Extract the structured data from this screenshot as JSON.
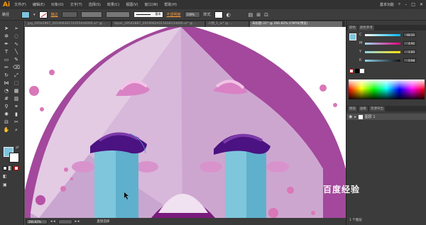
{
  "app": {
    "logo": "Ai"
  },
  "menu": {
    "items": [
      "文件(F)",
      "编辑(E)",
      "对象(O)",
      "文字(T)",
      "选择(S)",
      "效果(C)",
      "视图(V)",
      "窗口(W)",
      "帮助(H)"
    ],
    "workspace": "基本功能"
  },
  "control": {
    "path_label": "路径",
    "stroke_label": "描边",
    "brush_label": "基本",
    "opacity_label": "不透明度",
    "opacity_value": "100%",
    "style_label": "样式"
  },
  "tabs": [
    {
      "label": "jpg_29542867_20190626174355044000.ai* @ ...",
      "active": false
    },
    {
      "label": "Hpair_29542867_20190624311818154000.ai* @ ...",
      "active": false
    },
    {
      "label": "人物_1_ai* @ ...",
      "active": false
    },
    {
      "label": "未标题-31* @ 266.82% (CMYK/预览)",
      "active": true
    }
  ],
  "status": {
    "zoom": "266.82%",
    "tool": "直接选择"
  },
  "color_panel": {
    "tabs": [
      "颜色",
      "颜色参考"
    ],
    "channels": [
      {
        "label": "C",
        "value": "48.31",
        "color": "#00b7f0"
      },
      {
        "label": "M",
        "value": "4.91",
        "color": "#e5007e"
      },
      {
        "label": "Y",
        "value": "1.95",
        "color": "#ffe600"
      },
      {
        "label": "K",
        "value": "0.98",
        "color": "#111111"
      }
    ],
    "fill_color": "#7fc4dc"
  },
  "layers_panel": {
    "tabs": [
      "图层",
      "画板",
      "资源导出"
    ],
    "layer_name": "图层 1",
    "count_label": "1 个图层"
  },
  "watermark": "百度经验",
  "artwork_colors": {
    "face": "#c9a6cf",
    "face_light": "#e1c6e2",
    "hair": "#a3489c",
    "brow": "#d981c4",
    "eye": "#4b1281",
    "cheek": "#d993cc",
    "tear": "#7ec6dc",
    "tear_dark": "#5fb0cc",
    "mouth": "#7a1a7c",
    "dots": "#d977b8"
  }
}
